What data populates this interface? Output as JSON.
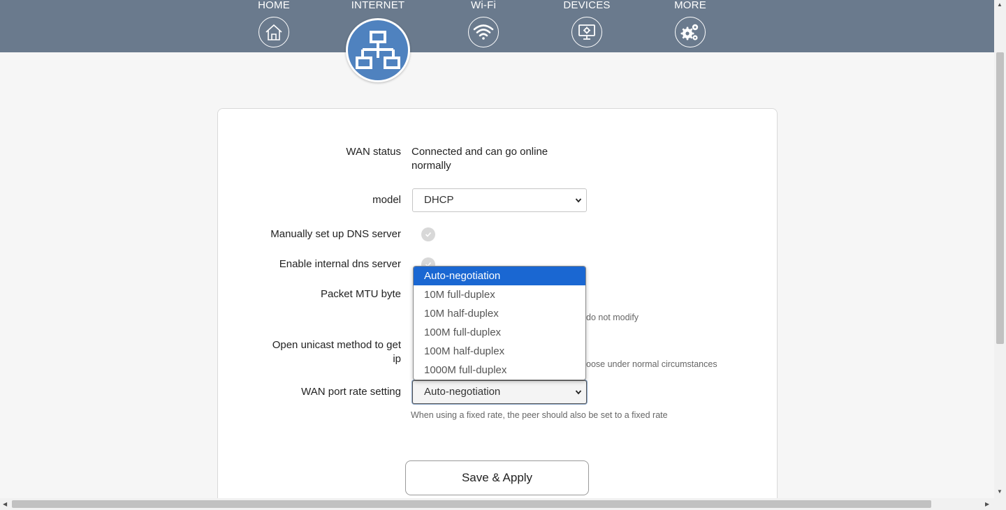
{
  "nav": {
    "items": [
      {
        "label": "HOME",
        "icon": "home-icon"
      },
      {
        "label": "INTERNET",
        "icon": "network-icon"
      },
      {
        "label": "Wi-Fi",
        "icon": "wifi-icon"
      },
      {
        "label": "DEVICES",
        "icon": "devices-icon"
      },
      {
        "label": "MORE",
        "icon": "gears-icon"
      }
    ],
    "active": "INTERNET"
  },
  "form": {
    "wan_status_label": "WAN status",
    "wan_status_value_line1": "Connected and can go online",
    "wan_status_value_line2": "normally",
    "model_label": "model",
    "model_value": "DHCP",
    "manual_dns_label": "Manually set up DNS server",
    "internal_dns_label": "Enable internal dns server",
    "mtu_label": "Packet MTU byte",
    "mtu_hint_partial": "do not modify",
    "unicast_label_line1": "Open unicast method to get",
    "unicast_label_line2": "ip",
    "unicast_hint_partial": "oose under normal circumstances",
    "wan_rate_label": "WAN port rate setting",
    "wan_rate_value": "Auto-negotiation",
    "wan_rate_hint": "When using a fixed rate, the peer should also be set to a fixed rate",
    "wan_rate_options": [
      "Auto-negotiation",
      "10M full-duplex",
      "10M half-duplex",
      "100M full-duplex",
      "100M half-duplex",
      "1000M full-duplex"
    ],
    "save_label": "Save & Apply"
  },
  "colors": {
    "topbar": "#6a7a8d",
    "active_icon": "#4f82bf",
    "option_selected": "#1a67d2"
  }
}
